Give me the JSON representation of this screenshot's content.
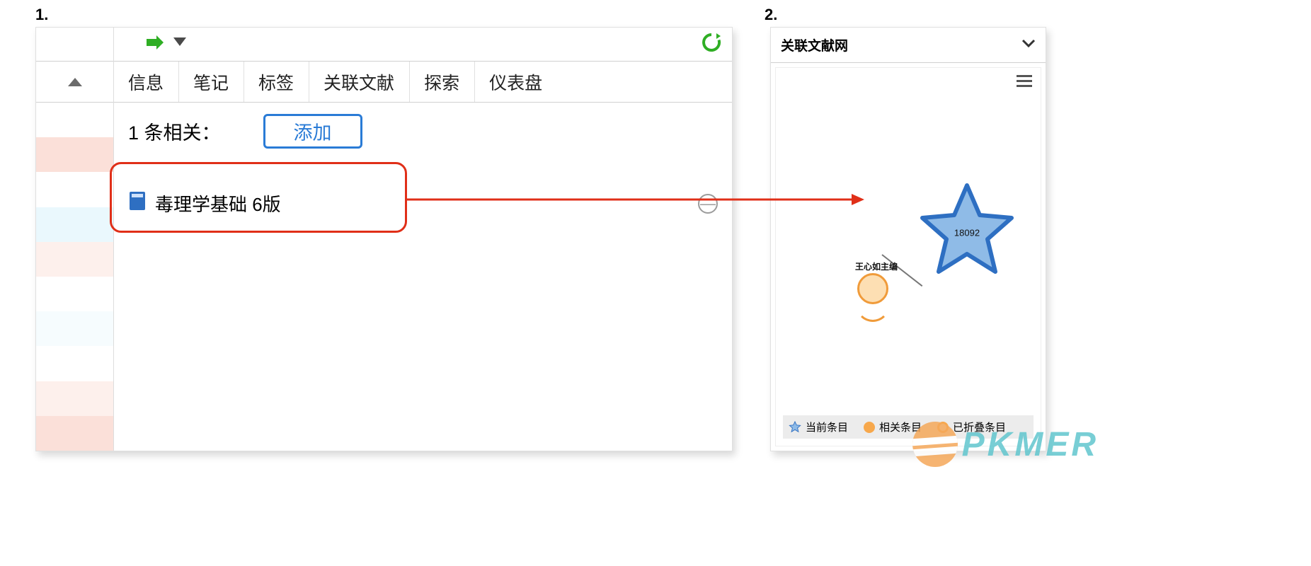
{
  "steps": {
    "one": "1.",
    "two": "2."
  },
  "panel1": {
    "tabs": {
      "info": "信息",
      "notes": "笔记",
      "tags": "标签",
      "related": "关联文献",
      "explore": "探索",
      "dashboard": "仪表盘"
    },
    "related_summary": "1 条相关：",
    "add_button": "添加",
    "book_title": "毒理学基础 6版"
  },
  "panel2": {
    "header": "关联文献网",
    "star_node_label": "18092",
    "circle_node_label": "王心如主编",
    "legend": {
      "current": "当前条目",
      "related": "相关条目",
      "collapsed": "已折叠条目"
    }
  },
  "watermark_text": "PKMER"
}
